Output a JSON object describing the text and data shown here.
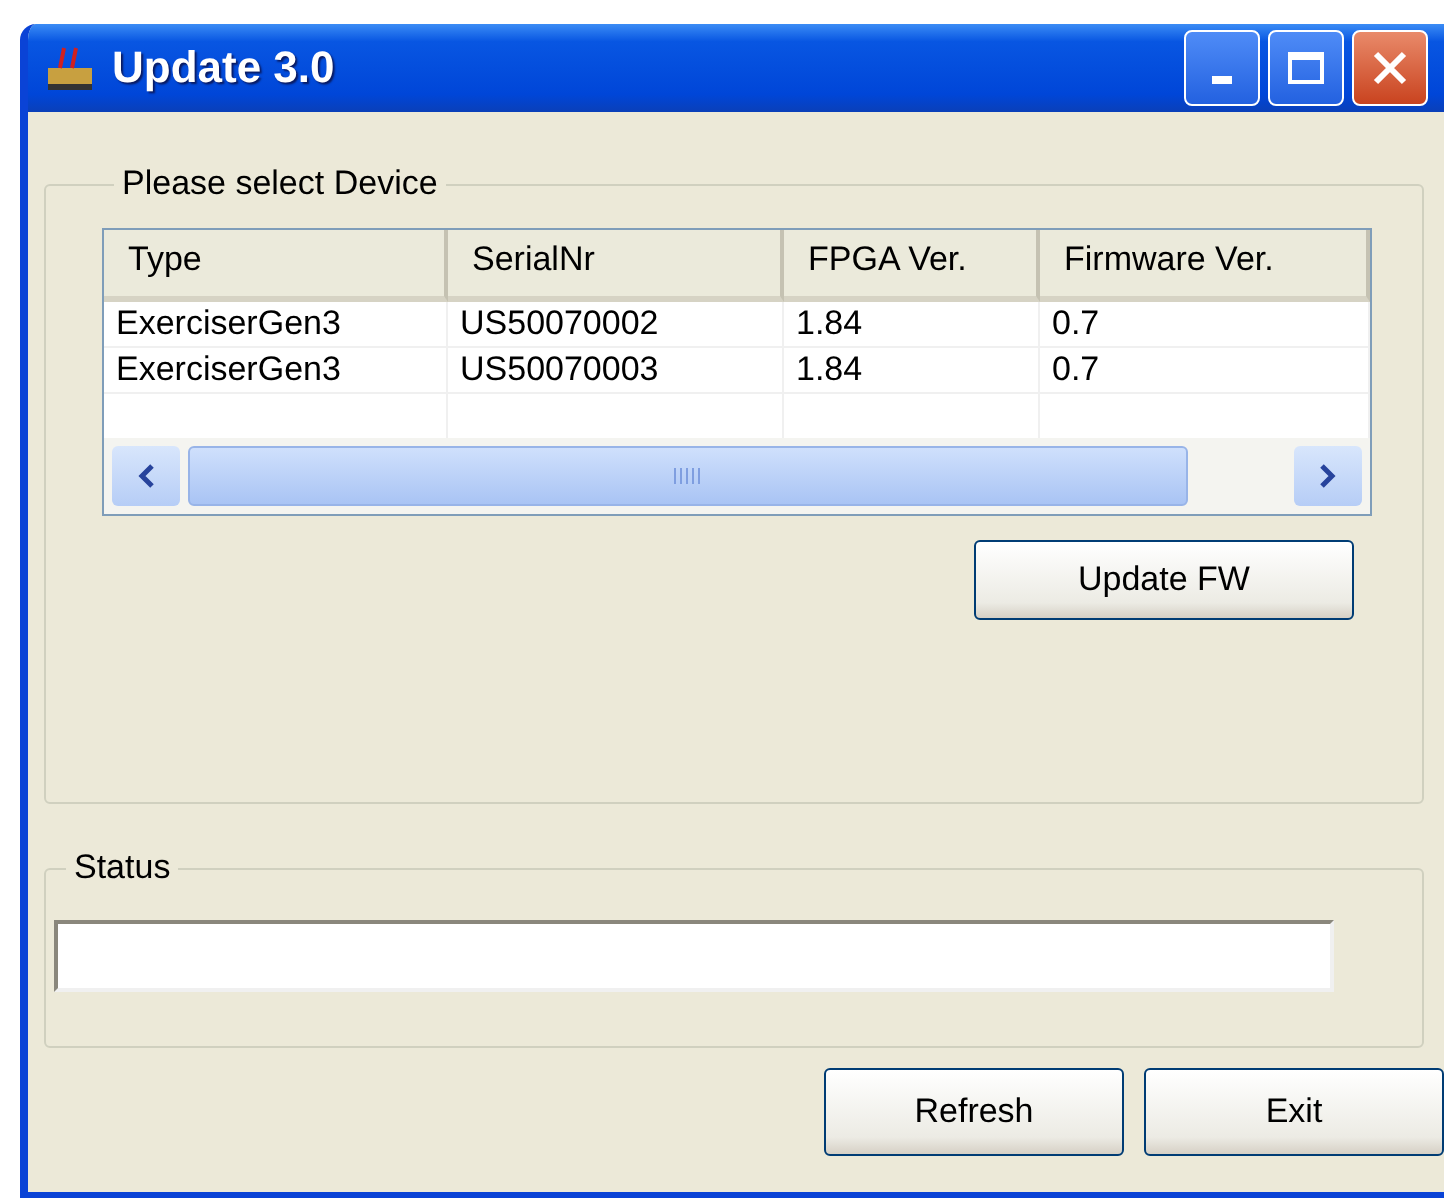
{
  "window": {
    "title": "Update 3.0"
  },
  "device_group": {
    "label": "Please select Device"
  },
  "table": {
    "columns": [
      "Type",
      "SerialNr",
      "FPGA Ver.",
      "Firmware Ver."
    ],
    "rows": [
      [
        "ExerciserGen3",
        "US50070002",
        "1.84",
        "0.7"
      ],
      [
        "ExerciserGen3",
        "US50070003",
        "1.84",
        "0.7"
      ]
    ]
  },
  "update_button": "Update FW",
  "status_group": {
    "label": "Status"
  },
  "buttons": [
    "Refresh",
    "Exit"
  ]
}
